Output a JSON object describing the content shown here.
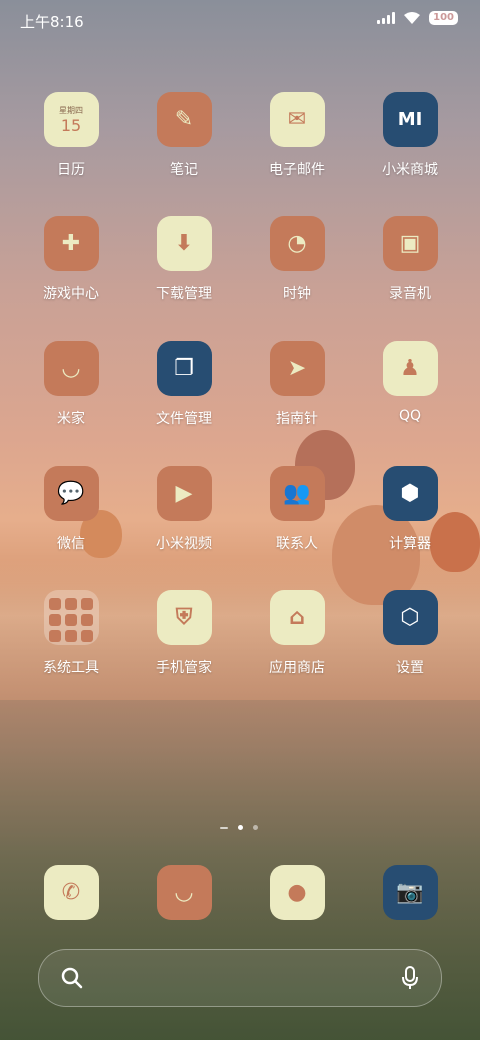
{
  "status_bar": {
    "time": "上午8:16",
    "battery": "100"
  },
  "calendar_widget": {
    "weekday": "星期四",
    "day": "15"
  },
  "apps": [
    {
      "label": "日历",
      "icon": "calendar-icon"
    },
    {
      "label": "笔记",
      "icon": "notes-icon"
    },
    {
      "label": "电子邮件",
      "icon": "mail-icon"
    },
    {
      "label": "小米商城",
      "icon": "mi-store-icon"
    },
    {
      "label": "游戏中心",
      "icon": "gamepad-icon"
    },
    {
      "label": "下载管理",
      "icon": "download-icon"
    },
    {
      "label": "时钟",
      "icon": "clock-icon"
    },
    {
      "label": "录音机",
      "icon": "recorder-icon"
    },
    {
      "label": "米家",
      "icon": "mijia-icon"
    },
    {
      "label": "文件管理",
      "icon": "files-icon"
    },
    {
      "label": "指南针",
      "icon": "compass-icon"
    },
    {
      "label": "QQ",
      "icon": "qq-icon"
    },
    {
      "label": "微信",
      "icon": "wechat-icon"
    },
    {
      "label": "小米视频",
      "icon": "video-icon"
    },
    {
      "label": "联系人",
      "icon": "contacts-icon"
    },
    {
      "label": "计算器",
      "icon": "calculator-icon"
    },
    {
      "label": "系统工具",
      "icon": "folder-icon"
    },
    {
      "label": "手机管家",
      "icon": "security-icon"
    },
    {
      "label": "应用商店",
      "icon": "app-store-icon"
    },
    {
      "label": "设置",
      "icon": "settings-icon"
    }
  ],
  "dock": [
    {
      "icon": "phone-icon"
    },
    {
      "icon": "browser-icon"
    },
    {
      "icon": "messages-icon"
    },
    {
      "icon": "camera-icon"
    }
  ],
  "colors": {
    "cream": "#ecebc2",
    "terracotta": "#c47a5a",
    "navy": "#274d72"
  }
}
